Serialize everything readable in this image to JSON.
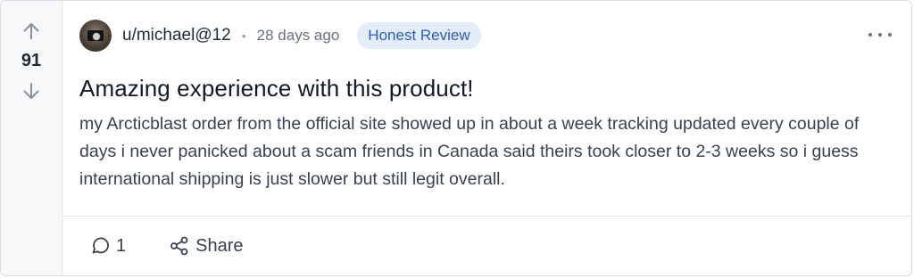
{
  "post": {
    "vote_count": "91",
    "author": "u/michael@12",
    "separator": "•",
    "timestamp": "28 days ago",
    "flair": "Honest Review",
    "title": "Amazing experience with this product!",
    "body": "my Arcticblast order from the official site showed up in about a week tracking updated every couple of days i never panicked about a scam friends in Canada said theirs took closer to 2-3 weeks so i guess international shipping is just slower but still legit overall."
  },
  "actions": {
    "comment_count": "1",
    "share_label": "Share"
  },
  "icons": {
    "upvote": "arrow-up-icon",
    "downvote": "arrow-down-icon",
    "more": "more-dots-icon",
    "comment": "comment-icon",
    "share": "share-icon",
    "avatar": "avatar"
  },
  "colors": {
    "flair_bg": "#e3ecfb",
    "flair_text": "#2f5fb3",
    "vote_column_bg": "#f7f8fa",
    "border": "#d9dde3"
  }
}
